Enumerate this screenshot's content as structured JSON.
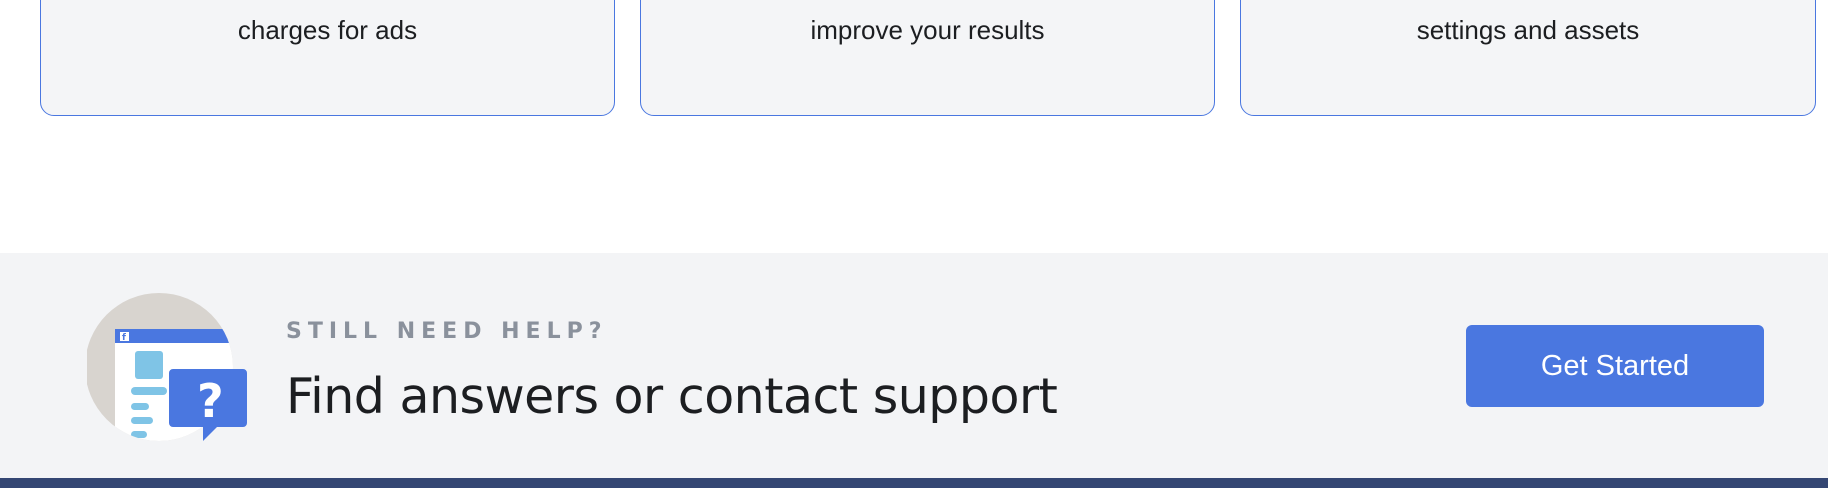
{
  "cards": [
    {
      "text": "charges for ads"
    },
    {
      "text": "improve your results"
    },
    {
      "text": "settings and assets"
    }
  ],
  "help": {
    "kicker": "STILL NEED HELP?",
    "headline": "Find answers or contact support",
    "button_label": "Get Started",
    "illustration_icon": "help-center-illustration",
    "colors": {
      "accent": "#4a77e0",
      "band_background": "#f3f4f6",
      "footer": "#344673"
    }
  }
}
